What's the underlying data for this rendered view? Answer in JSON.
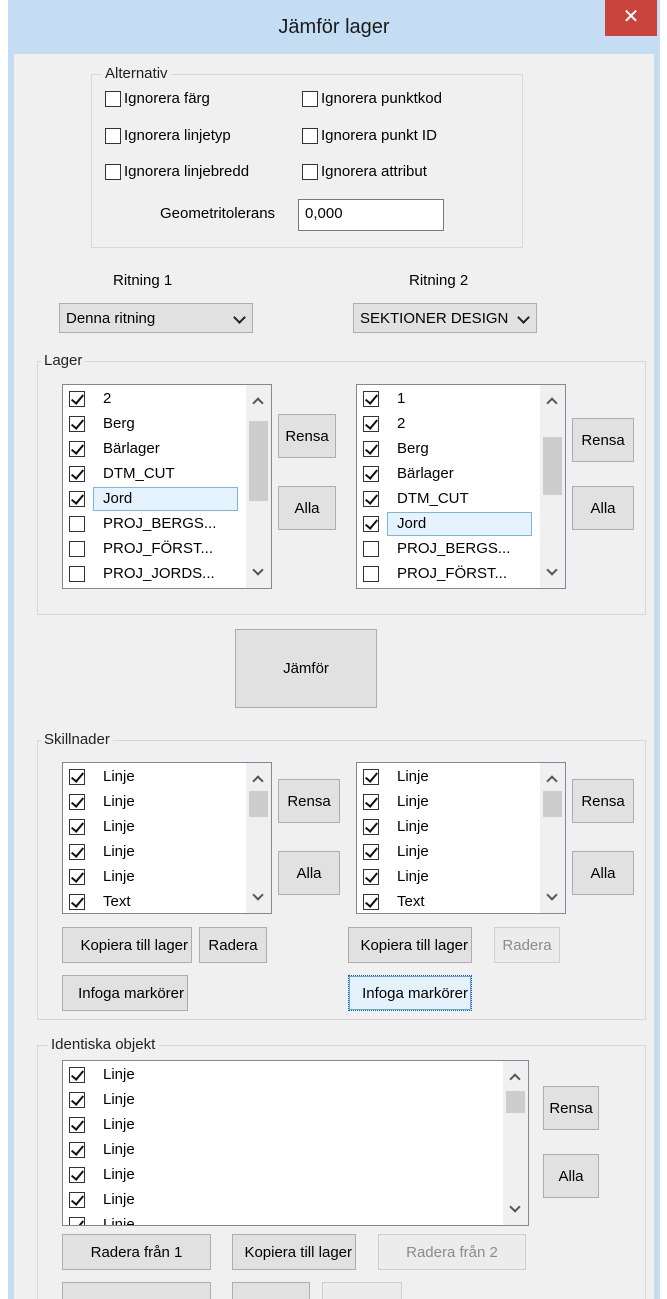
{
  "window": {
    "title": "Jämför lager",
    "close_label": "✕"
  },
  "options": {
    "group_label": "Alternativ",
    "checks": [
      {
        "label": "Ignorera färg",
        "checked": false
      },
      {
        "label": "Ignorera punktkod",
        "checked": false
      },
      {
        "label": "Ignorera linjetyp",
        "checked": false
      },
      {
        "label": "Ignorera punkt ID",
        "checked": false
      },
      {
        "label": "Ignorera linjebredd",
        "checked": false
      },
      {
        "label": "Ignorera attribut",
        "checked": false
      }
    ],
    "tolerance_label": "Geometritolerans",
    "tolerance_value": "0,000"
  },
  "drawings": {
    "label1": "Ritning 1",
    "label2": "Ritning 2",
    "select1": "Denna ritning",
    "select2": "SEKTIONER DESIGN"
  },
  "layers": {
    "group_label": "Lager",
    "list1": [
      {
        "label": "2",
        "checked": true
      },
      {
        "label": "Berg",
        "checked": true
      },
      {
        "label": "Bärlager",
        "checked": true
      },
      {
        "label": "DTM_CUT",
        "checked": true
      },
      {
        "label": "Jord",
        "checked": true,
        "selected": true
      },
      {
        "label": "PROJ_BERGS...",
        "checked": false
      },
      {
        "label": "PROJ_FÖRST...",
        "checked": false
      },
      {
        "label": "PROJ_JORDS...",
        "checked": false
      }
    ],
    "list2": [
      {
        "label": "1",
        "checked": true
      },
      {
        "label": "2",
        "checked": true
      },
      {
        "label": "Berg",
        "checked": true
      },
      {
        "label": "Bärlager",
        "checked": true
      },
      {
        "label": "DTM_CUT",
        "checked": true
      },
      {
        "label": "Jord",
        "checked": true,
        "selected": true
      },
      {
        "label": "PROJ_BERGS...",
        "checked": false
      },
      {
        "label": "PROJ_FÖRST...",
        "checked": false
      }
    ],
    "clear_label": "Rensa",
    "all_label": "Alla"
  },
  "compare_label": "Jämför",
  "differences": {
    "group_label": "Skillnader",
    "list1": [
      {
        "label": "Linje",
        "checked": true
      },
      {
        "label": "Linje",
        "checked": true
      },
      {
        "label": "Linje",
        "checked": true
      },
      {
        "label": "Linje",
        "checked": true
      },
      {
        "label": "Linje",
        "checked": true
      },
      {
        "label": "Text",
        "checked": true
      }
    ],
    "list2": [
      {
        "label": "Linje",
        "checked": true
      },
      {
        "label": "Linje",
        "checked": true
      },
      {
        "label": "Linje",
        "checked": true
      },
      {
        "label": "Linje",
        "checked": true
      },
      {
        "label": "Linje",
        "checked": true
      },
      {
        "label": "Text",
        "checked": true
      }
    ],
    "clear_label": "Rensa",
    "all_label": "Alla",
    "copy_label": "Kopiera till lager",
    "delete_label": "Radera",
    "insert_markers_label": "Infoga markörer"
  },
  "identical": {
    "group_label": "Identiska objekt",
    "list": [
      {
        "label": "Linje",
        "checked": true
      },
      {
        "label": "Linje",
        "checked": true
      },
      {
        "label": "Linje",
        "checked": true
      },
      {
        "label": "Linje",
        "checked": true
      },
      {
        "label": "Linje",
        "checked": true
      },
      {
        "label": "Linje",
        "checked": true
      },
      {
        "label": "Linje",
        "checked": true
      }
    ],
    "clear_label": "Rensa",
    "all_label": "Alla",
    "delete_from1_label": "Radera från 1",
    "copy_label": "Kopiera till lager",
    "delete_from2_label": "Radera från 2"
  }
}
